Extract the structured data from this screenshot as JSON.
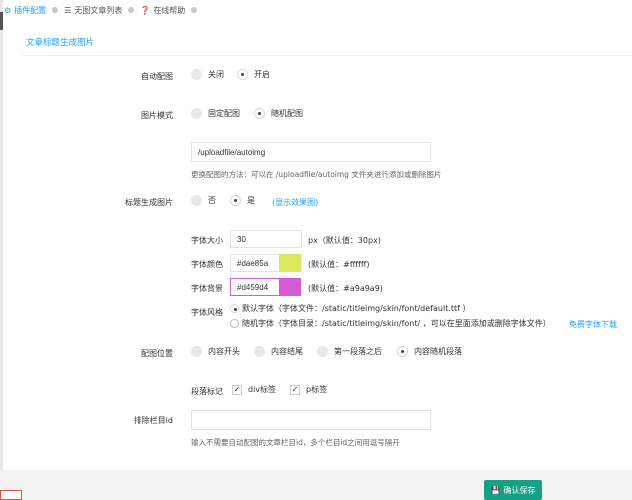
{
  "tabs": [
    {
      "label": "插件配置",
      "icon": "gear-icon",
      "active": true
    },
    {
      "label": "无图文章列表",
      "icon": "list-icon",
      "active": false
    },
    {
      "label": "在线帮助",
      "icon": "help-icon",
      "active": false
    }
  ],
  "section_title": "文章标题生成图片",
  "auto_config": {
    "label": "自动配图",
    "options": [
      "关闭",
      "开启"
    ],
    "selected": "开启"
  },
  "image_mode": {
    "label": "图片模式",
    "options": [
      "固定配图",
      "随机配图"
    ],
    "selected": "随机配图"
  },
  "upload_path": {
    "value": "/uploadfile/autoimg",
    "hint": "更换配图的方法：可以在 /uploadfile/autoimg 文件夹进行添加或删除图片"
  },
  "title_image": {
    "label": "标题生成图片",
    "options": [
      "否",
      "是"
    ],
    "selected": "是",
    "link": "(显示效果图)"
  },
  "font_size": {
    "label": "字体大小",
    "value": "30",
    "suffix": "px（默认值：30px)"
  },
  "font_color": {
    "label": "字体颜色",
    "value": "#dae85a",
    "default": "(默认值：#ffffff)",
    "swatch": "#dae85a"
  },
  "font_bg": {
    "label": "字体背景",
    "value": "#d459d4",
    "default": "(默认值：#a9a9a9)",
    "swatch": "#d459d4"
  },
  "font_style": {
    "label": "字体风格",
    "opt1": "默认字体（字体文件：/static/titleimg/skin/font/default.ttf ）",
    "opt2": "随机字体（字体目录：/static/titleimg/skin/font/ ，可以在里面添加或删除字体文件）",
    "link": "免费字体下载",
    "selected": "默认字体"
  },
  "position": {
    "label": "配图位置",
    "options": [
      "内容开头",
      "内容结尾",
      "第一段落之后",
      "内容随机段落"
    ],
    "selected": "内容随机段落"
  },
  "para_tag": {
    "label": "段落标记",
    "options": [
      "div标签",
      "p标签"
    ],
    "checked": [
      true,
      true
    ]
  },
  "exclude": {
    "label": "排除栏目id",
    "value": "",
    "hint": "输入不需要自动配图的文章栏目id，多个栏目id之间用逗号隔开"
  },
  "save_label": "确认保存"
}
